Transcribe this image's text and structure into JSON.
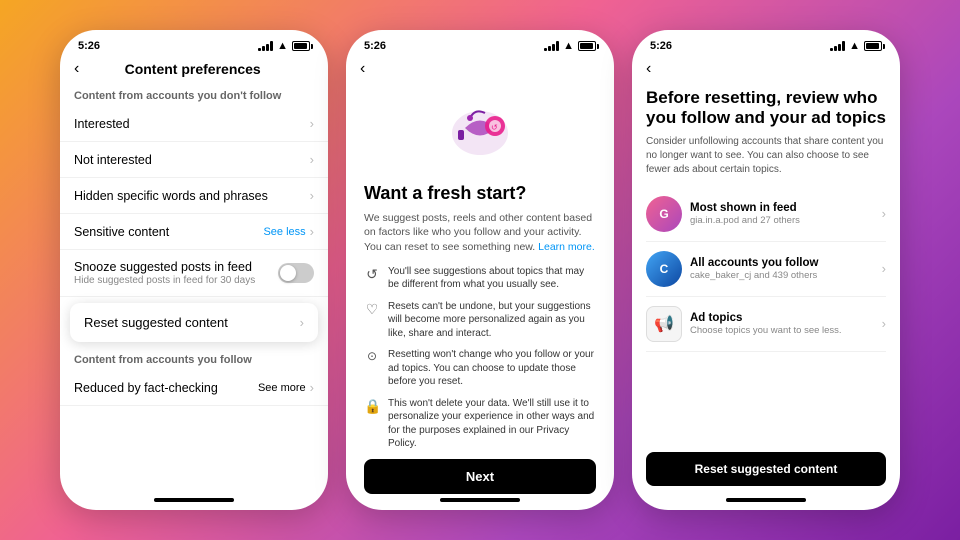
{
  "phone1": {
    "time": "5:26",
    "title": "Content preferences",
    "sections": [
      {
        "header": "Content from accounts you don't follow",
        "items": [
          {
            "label": "Interested",
            "type": "chevron"
          },
          {
            "label": "Not interested",
            "type": "chevron"
          },
          {
            "label": "Hidden specific words and phrases",
            "type": "chevron"
          },
          {
            "label": "Sensitive content",
            "right": "See less",
            "type": "see-less"
          },
          {
            "label": "Snooze suggested posts in feed",
            "sub": "Hide suggested posts in feed for 30 days",
            "type": "toggle"
          }
        ]
      },
      {
        "reset_label": "Reset suggested content",
        "type": "reset-box"
      },
      {
        "header": "Content from accounts you follow",
        "items": [
          {
            "label": "Reduced by fact-checking",
            "right": "See more",
            "type": "see-more"
          }
        ]
      }
    ]
  },
  "phone2": {
    "time": "5:26",
    "title": "Want a fresh start?",
    "description": "We suggest posts, reels and other content based on factors like who you follow and your activity. You can reset to see something new.",
    "learn_more": "Learn more.",
    "info_items": [
      {
        "icon": "↺",
        "text": "You'll see suggestions about topics that may be different from what you usually see."
      },
      {
        "icon": "♡",
        "text": "Resets can't be undone, but your suggestions will become more personalized again as you like, share and interact."
      },
      {
        "icon": "👤",
        "text": "Resetting won't change who you follow or your ad topics. You can choose to update those before you reset."
      },
      {
        "icon": "🔒",
        "text": "This won't delete your data. We'll still use it to personalize your experience in other ways and for the purposes explained in our Privacy Policy."
      }
    ],
    "next_button": "Next"
  },
  "phone3": {
    "time": "5:26",
    "title": "Before resetting, review who you follow and your ad topics",
    "description": "Consider unfollowing accounts that share content you no longer want to see. You can also choose to see fewer ads about certain topics.",
    "review_items": [
      {
        "type": "avatar",
        "color": "purple",
        "initials": "G",
        "title": "Most shown in feed",
        "sub": "gia.in.a.pod and 27 others"
      },
      {
        "type": "avatar",
        "color": "blue",
        "initials": "C",
        "title": "All accounts you follow",
        "sub": "cake_baker_cj and 439 others"
      },
      {
        "type": "icon",
        "icon": "📢",
        "title": "Ad topics",
        "sub": "Choose topics you want to see less."
      }
    ],
    "reset_button": "Reset suggested content"
  }
}
